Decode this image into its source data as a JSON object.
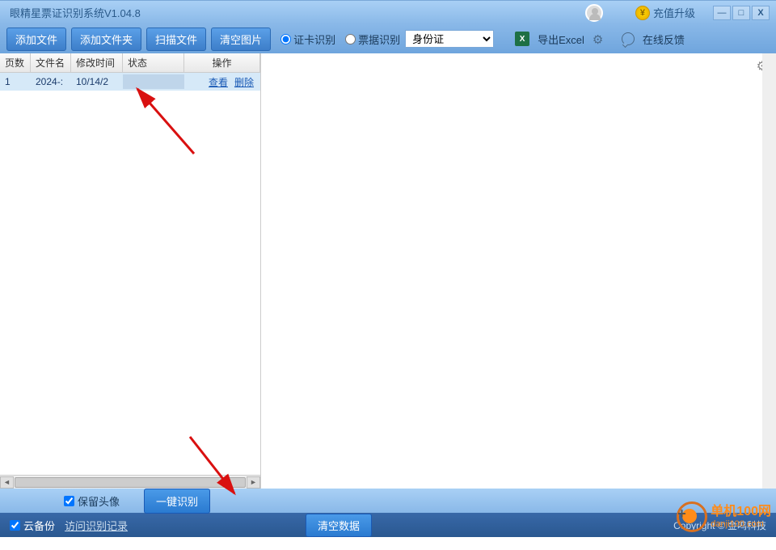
{
  "titlebar": {
    "title": "眼精星票证识别系统V1.04.8",
    "recharge": "充值升级"
  },
  "toolbar": {
    "add_file": "添加文件",
    "add_folder": "添加文件夹",
    "scan_file": "扫描文件",
    "clear_images": "清空图片",
    "radio_cert": "证卡识别",
    "radio_receipt": "票据识别",
    "select_value": "身份证",
    "export_excel": "导出Excel",
    "feedback": "在线反馈"
  },
  "table": {
    "headers": {
      "pages": "页数",
      "filename": "文件名",
      "mtime": "修改时间",
      "status": "状态",
      "ops": "操作"
    },
    "rows": [
      {
        "pages": "1",
        "filename": "2024-:",
        "mtime": "10/14/2",
        "status": "",
        "view": "查看",
        "delete": "删除"
      }
    ]
  },
  "bottom1": {
    "keep_avatar": "保留头像",
    "recognize": "一键识别"
  },
  "bottom2": {
    "cloud_backup": "云备份",
    "history": "访问识别记录",
    "clear_data": "清空数据",
    "copyright": "Copyright © 金鸣科技"
  },
  "watermark": {
    "cn": "单机100网",
    "en": "danji100.com"
  }
}
